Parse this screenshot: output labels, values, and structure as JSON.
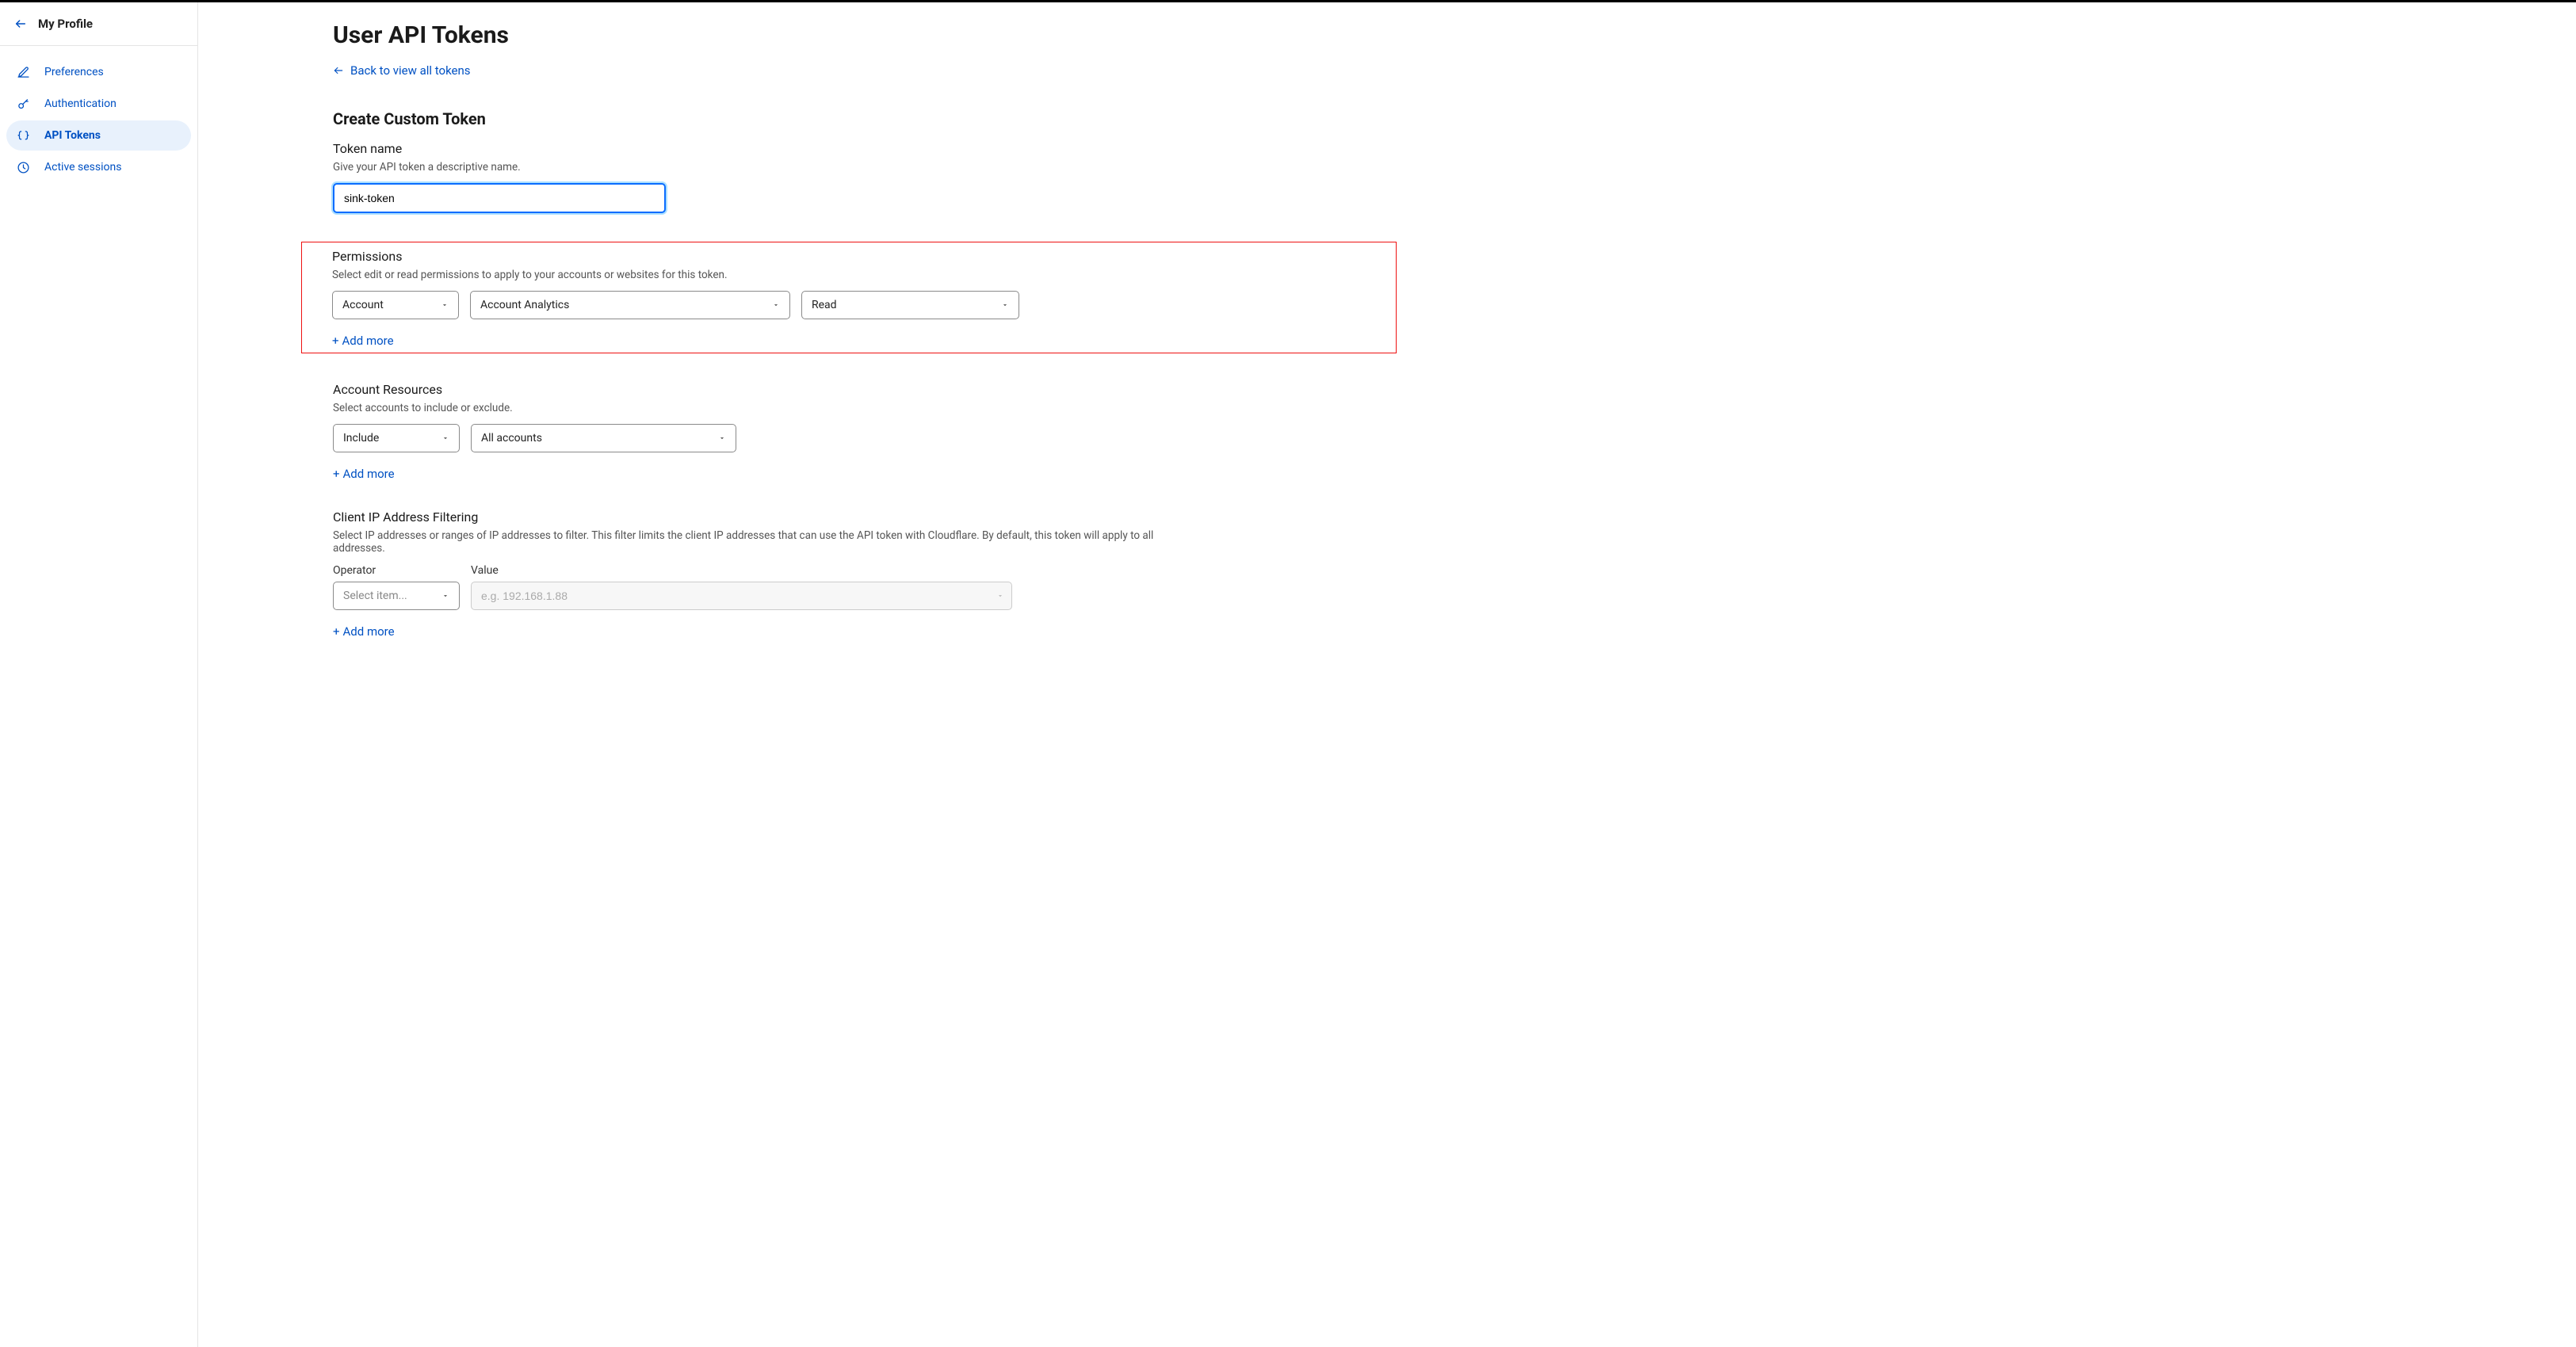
{
  "sidebar": {
    "title": "My Profile",
    "items": [
      {
        "label": "Preferences"
      },
      {
        "label": "Authentication"
      },
      {
        "label": "API Tokens"
      },
      {
        "label": "Active sessions"
      }
    ]
  },
  "page": {
    "title": "User API Tokens",
    "back_link": "Back to view all tokens"
  },
  "create": {
    "heading": "Create Custom Token",
    "token_name": {
      "label": "Token name",
      "desc": "Give your API token a descriptive name.",
      "value": "sink-token"
    },
    "permissions": {
      "label": "Permissions",
      "desc": "Select edit or read permissions to apply to your accounts or websites for this token.",
      "scope": "Account",
      "resource": "Account Analytics",
      "level": "Read",
      "add_more": "Add more"
    },
    "account_resources": {
      "label": "Account Resources",
      "desc": "Select accounts to include or exclude.",
      "mode": "Include",
      "target": "All accounts",
      "add_more": "Add more"
    },
    "ip_filter": {
      "label": "Client IP Address Filtering",
      "desc": "Select IP addresses or ranges of IP addresses to filter. This filter limits the client IP addresses that can use the API token with Cloudflare. By default, this token will apply to all addresses.",
      "operator_label": "Operator",
      "value_label": "Value",
      "operator_placeholder": "Select item...",
      "value_placeholder": "e.g. 192.168.1.88",
      "add_more": "Add more"
    }
  }
}
